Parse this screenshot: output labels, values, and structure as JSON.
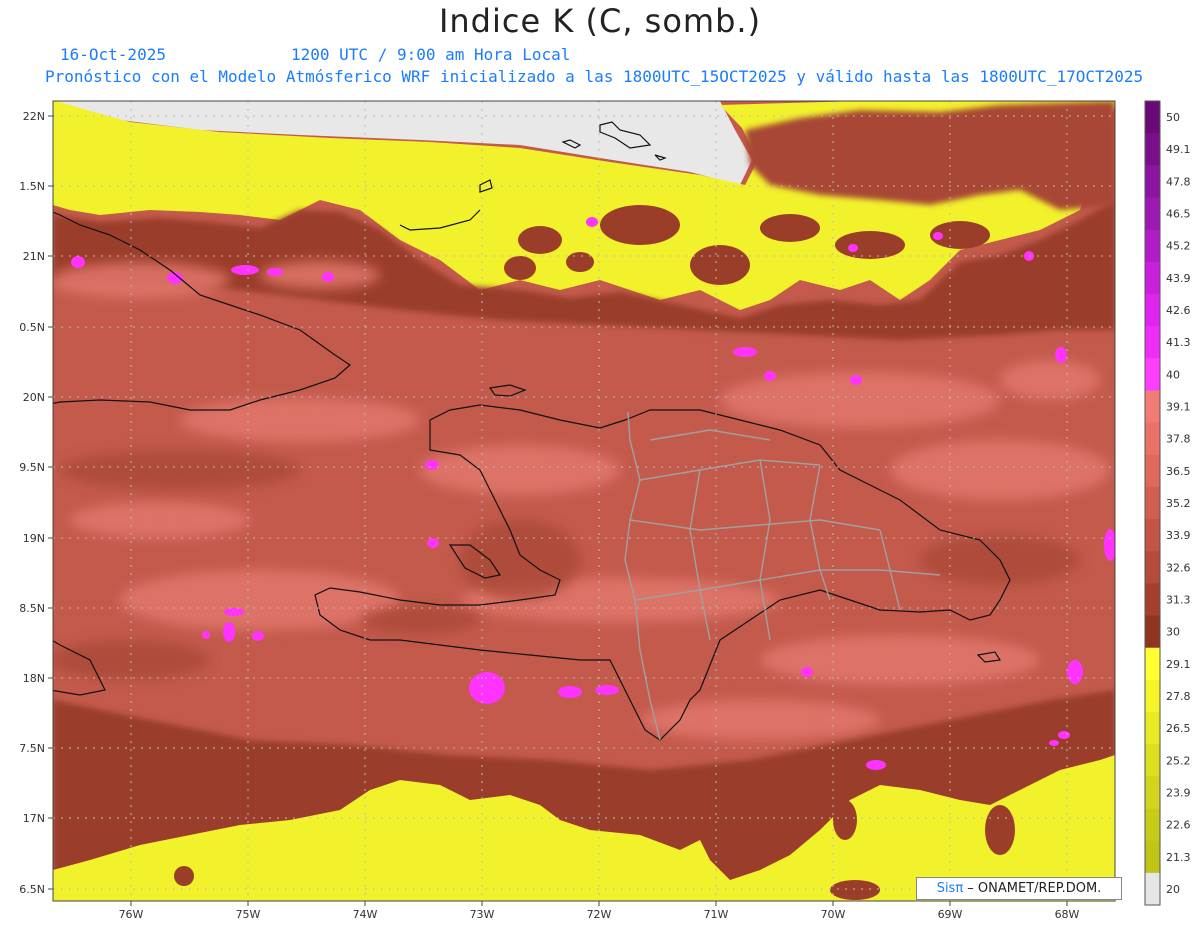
{
  "title": "Indice K (C, somb.)",
  "date": "16-Oct-2025",
  "time": "1200 UTC / 9:00 am Hora Local",
  "description": "Pronóstico con el Modelo Atmósferico WRF inicializado a las 1800UTC_15OCT2025 y válido hasta las  1800UTC_17OCT2025",
  "credit": {
    "brand": "Sisπ",
    "text": " – ONAMET/REP.DOM."
  },
  "lat_labels": [
    "22N",
    "1.5N",
    "21N",
    "0.5N",
    "20N",
    "9.5N",
    "19N",
    "8.5N",
    "18N",
    "7.5N",
    "17N",
    "6.5N"
  ],
  "lon_labels": [
    "76W",
    "75W",
    "74W",
    "73W",
    "72W",
    "71W",
    "70W",
    "69W",
    "68W"
  ],
  "colorbar": {
    "labels": [
      "50",
      "49.1",
      "47.8",
      "46.5",
      "45.2",
      "43.9",
      "42.6",
      "41.3",
      "40",
      "39.1",
      "37.8",
      "36.5",
      "35.2",
      "33.9",
      "32.6",
      "31.3",
      "30",
      "29.1",
      "27.8",
      "26.5",
      "25.2",
      "23.9",
      "22.6",
      "21.3",
      "20"
    ],
    "colors": [
      "#6a0a78",
      "#7a0f8c",
      "#8c14a0",
      "#9e18b4",
      "#b21cc8",
      "#c820dc",
      "#de24ee",
      "#f02cf8",
      "#ff3dff",
      "#f27b76",
      "#ea7068",
      "#e0685d",
      "#d25e52",
      "#c55448",
      "#b64a3c",
      "#a63e30",
      "#8f3420",
      "#ffff33",
      "#f5f52a",
      "#e8ea24",
      "#dcde20",
      "#d2d41d",
      "#c9cb19",
      "#c1c316",
      "#e6e6e6"
    ]
  },
  "colors": {
    "land_none": "#e8e8e8",
    "yellow": "#f2f22c",
    "dark": "#9a3e2a",
    "mid": "#c35a4c",
    "light": "#e2776c",
    "magenta": "#ff33ff",
    "accent_text": "#1a7cff"
  }
}
